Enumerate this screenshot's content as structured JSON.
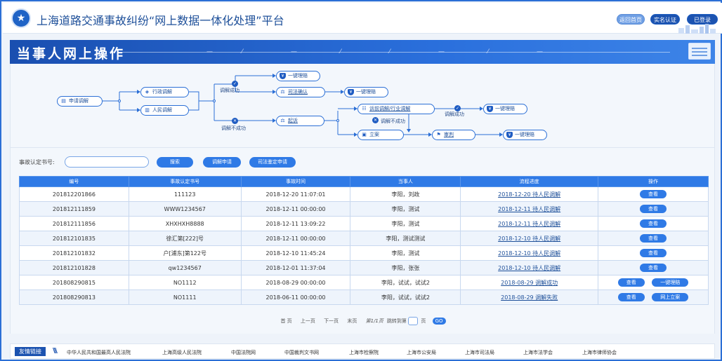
{
  "header": {
    "title": "上海道路交通事故纠纷“网上数据一体化处理”平台",
    "buttons": {
      "back": "返回首页",
      "realname": "实名认证",
      "login": "已登录"
    }
  },
  "banner": {
    "title": "当事人网上操作"
  },
  "flow": {
    "start": "申请调解",
    "admin": "行政调解",
    "people": "人民调解",
    "success_label": "调解成功",
    "fail_label": "调解不成功",
    "one_key_claim": "一键理赔",
    "judicial_confirm": "司法确认",
    "sue": "起诉",
    "pre_litigation": "诉前调解/行业调解",
    "file_case": "立案",
    "trial": "审判",
    "success_label_2": "调解成功",
    "fail_label_2": "调解不成功"
  },
  "search": {
    "label": "事故认定书号:",
    "placeholder": "",
    "buttons": {
      "search": "搜索",
      "apply_mediation": "调解申请",
      "apply_appraisal": "司法鉴定申请"
    }
  },
  "table": {
    "headers": [
      "编号",
      "事故认定书号",
      "事故时间",
      "当事人",
      "流程进度",
      "操作"
    ],
    "rows": [
      {
        "id": "201812201866",
        "cert": "111123",
        "time": "2018-12-20 11:07:01",
        "parties": "李阳，刘政",
        "progress": "2018-12-20 待人民调解",
        "actions": [
          "查看"
        ]
      },
      {
        "id": "201812111859",
        "cert": "WWW1234567",
        "time": "2018-12-11 00:00:00",
        "parties": "李阳，测试",
        "progress": "2018-12-11 待人民调解",
        "actions": [
          "查看"
        ]
      },
      {
        "id": "201812111856",
        "cert": "XHXHXH8888",
        "time": "2018-12-11 13:09:22",
        "parties": "李阳，测试",
        "progress": "2018-12-11 待人民调解",
        "actions": [
          "查看"
        ]
      },
      {
        "id": "201812101835",
        "cert": "徐汇第[222]号",
        "time": "2018-12-11 00:00:00",
        "parties": "李阳，测试测试",
        "progress": "2018-12-10 待人民调解",
        "actions": [
          "查看"
        ]
      },
      {
        "id": "201812101832",
        "cert": "户[浦东]第122号",
        "time": "2018-12-10 11:45:24",
        "parties": "李阳，测试",
        "progress": "2018-12-10 待人民调解",
        "actions": [
          "查看"
        ]
      },
      {
        "id": "201812101828",
        "cert": "qw1234567",
        "time": "2018-12-01 11:37:04",
        "parties": "李阳，张张",
        "progress": "2018-12-10 待人民调解",
        "actions": [
          "查看"
        ]
      },
      {
        "id": "201808290815",
        "cert": "NO1112",
        "time": "2018-08-29 00:00:00",
        "parties": "李阳，试试，试试2",
        "progress": "2018-08-29 调解成功",
        "actions": [
          "查看",
          "一键理赔"
        ]
      },
      {
        "id": "201808290813",
        "cert": "NO1111",
        "time": "2018-06-11 00:00:00",
        "parties": "李阳，试试，试试2",
        "progress": "2018-08-29 调解失败",
        "actions": [
          "查看",
          "网上立案"
        ]
      }
    ]
  },
  "pager": {
    "first": "首 页",
    "prev": "上一页",
    "next": "下一页",
    "last": "末页",
    "info": "第1/1页",
    "jump_prefix": "跳转到第",
    "jump_suffix": "页",
    "go": "GO"
  },
  "footer": {
    "tag": "友情链接",
    "links": [
      "中华人民共和国最高人民法院",
      "上海高级人民法院",
      "中国法院网",
      "中国裁判文书网",
      "上海市检察院",
      "上海市公安局",
      "上海市司法局",
      "上海市法学会",
      "上海市律师协会"
    ]
  }
}
